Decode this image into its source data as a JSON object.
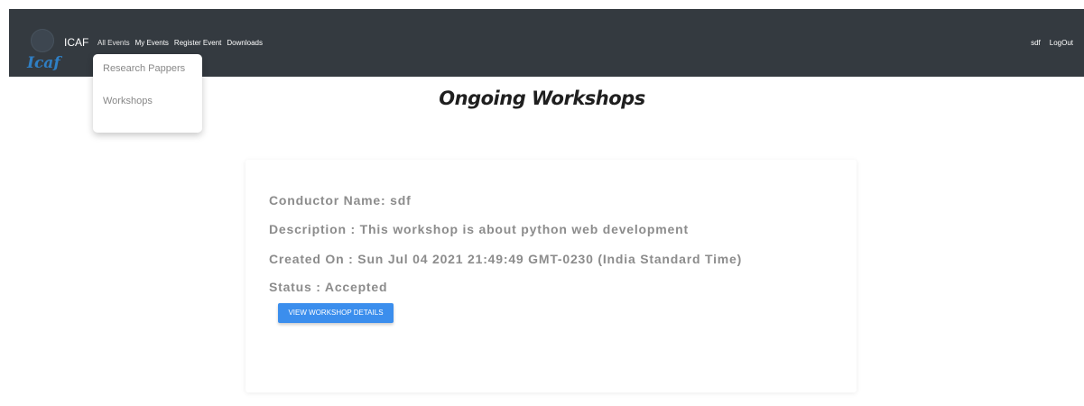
{
  "nav": {
    "brand_name": "ICAF",
    "brand_script": "Icaf",
    "links": [
      "All Events",
      "My Events",
      "Register Event",
      "Downloads"
    ],
    "user": "sdf",
    "logout": "LogOut"
  },
  "dropdown": {
    "items": [
      "Research Pappers",
      "Workshops"
    ]
  },
  "page": {
    "title": "Ongoing Workshops"
  },
  "workshop": {
    "conductor": "Conductor Name: sdf",
    "description": "Description : This workshop is about python web development",
    "created": "Created On : Sun Jul 04 2021 21:49:49 GMT-0230 (India Standard Time)",
    "status": "Status : Accepted",
    "button": "VIEW WORKSHOP DETAILS"
  },
  "colors": {
    "navbar": "#343a40",
    "button": "#3b8eed"
  }
}
